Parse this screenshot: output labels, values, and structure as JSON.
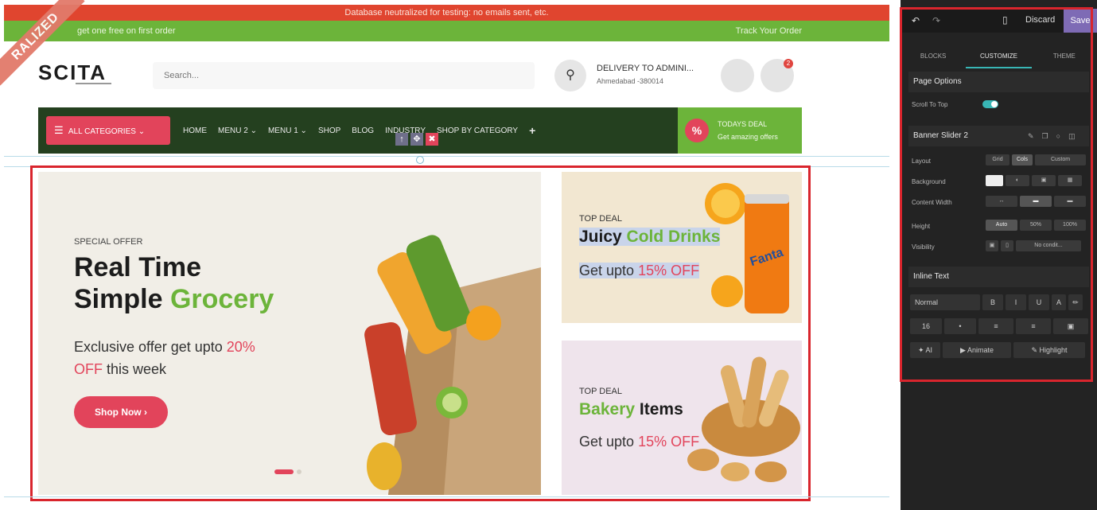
{
  "top_banner": "Database neutralized for testing: no emails sent, etc.",
  "ribbon": "RALIZED",
  "promo_bar": {
    "text": "get one free on first order",
    "track_order": "Track Your Order"
  },
  "header": {
    "logo": "SCITA",
    "search_placeholder": "Search...",
    "search_icon": "search-icon",
    "delivery_title": "DELIVERY TO ADMINI...",
    "delivery_address": "Ahmedabad -380014",
    "cart_count": "2"
  },
  "nav": {
    "all_categories": "ALL CATEGORIES",
    "items": [
      "HOME",
      "MENU 2",
      "MENU 1",
      "SHOP",
      "BLOG",
      "INDUSTRY",
      "SHOP BY CATEGORY",
      "+"
    ],
    "deal_title": "TODAYS DEAL",
    "deal_sub": "Get amazing offers"
  },
  "hero": {
    "eyebrow": "SPECIAL OFFER",
    "line1": "Real Time",
    "line2_a": "Simple ",
    "line2_b": "Grocery",
    "desc_a": "Exclusive offer get upto ",
    "desc_b": "20%",
    "desc_c": "OFF",
    "desc_d": " this week",
    "button": "Shop Now",
    "active_slide": 1,
    "slide_count": 2
  },
  "card1": {
    "tag": "TOP DEAL",
    "title_a": "Juicy ",
    "title_b": "Cold Drinks",
    "sub_a": "Get upto ",
    "sub_b": "15% OFF",
    "brand": "Fanta"
  },
  "card2": {
    "tag": "TOP DEAL",
    "title_a": "Bakery",
    "title_b": " Items",
    "sub_a": "Get upto ",
    "sub_b": "15% OFF"
  },
  "panel": {
    "discard": "Discard",
    "save": "Save",
    "tabs": [
      "BLOCKS",
      "CUSTOMIZE",
      "THEME"
    ],
    "active_tab": "CUSTOMIZE",
    "page_options": "Page Options",
    "scroll_to_top": "Scroll To Top",
    "banner_title": "Banner Slider 2",
    "rows": [
      "Layout",
      "Background",
      "Content Width",
      "Height",
      "Visibility"
    ],
    "layout_opts": [
      "Grid",
      "Cols",
      "Custom"
    ],
    "height_opts": [
      "Auto",
      "50%",
      "100%"
    ],
    "visibility_value": "No condit...",
    "inline_text": "Inline Text",
    "style_select": "Normal",
    "format_buttons": [
      "B",
      "I",
      "U",
      "A"
    ],
    "font_size": "16",
    "ai_button": "AI",
    "animate_button": "Animate",
    "highlight_button": "Highlight"
  },
  "colors": {
    "accent": "#e2445b",
    "green": "#6cb43a",
    "nav": "#24401f",
    "panel": "#232323",
    "save": "#7e6bb5",
    "teal": "#38b6b5"
  }
}
